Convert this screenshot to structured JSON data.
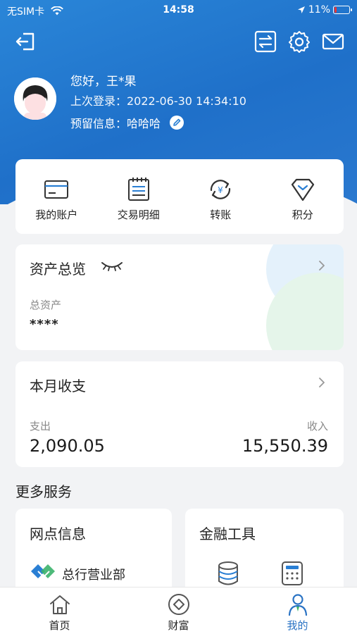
{
  "status_bar": {
    "carrier": "无SIM卡",
    "time": "14:58",
    "battery": "11%"
  },
  "profile": {
    "greeting": "您好，王*果",
    "last_login": "上次登录：2022-06-30 14:34:10",
    "reserved_info_label": "预留信息：",
    "reserved_info_value": "哈哈哈"
  },
  "quick_actions": [
    {
      "label": "我的账户",
      "icon": "card-icon"
    },
    {
      "label": "交易明细",
      "icon": "receipt-icon"
    },
    {
      "label": "转账",
      "icon": "transfer-icon"
    },
    {
      "label": "积分",
      "icon": "diamond-icon"
    }
  ],
  "assets": {
    "title": "资产总览",
    "total_label": "总资产",
    "total_value": "****"
  },
  "monthly": {
    "title": "本月收支",
    "expense_label": "支出",
    "expense_value": "2,090.05",
    "income_label": "收入",
    "income_value": "15,550.39"
  },
  "more_services": {
    "title": "更多服务",
    "branch": {
      "title": "网点信息",
      "item": "总行营业部"
    },
    "finance": {
      "title": "金融工具"
    }
  },
  "tabbar": {
    "tabs": [
      {
        "label": "首页",
        "icon": "home-icon"
      },
      {
        "label": "财富",
        "icon": "wealth-icon"
      },
      {
        "label": "我的",
        "icon": "profile-icon"
      }
    ],
    "active": "我的"
  },
  "colors": {
    "primary": "#2a73c4",
    "hero": "#2a86d8"
  }
}
